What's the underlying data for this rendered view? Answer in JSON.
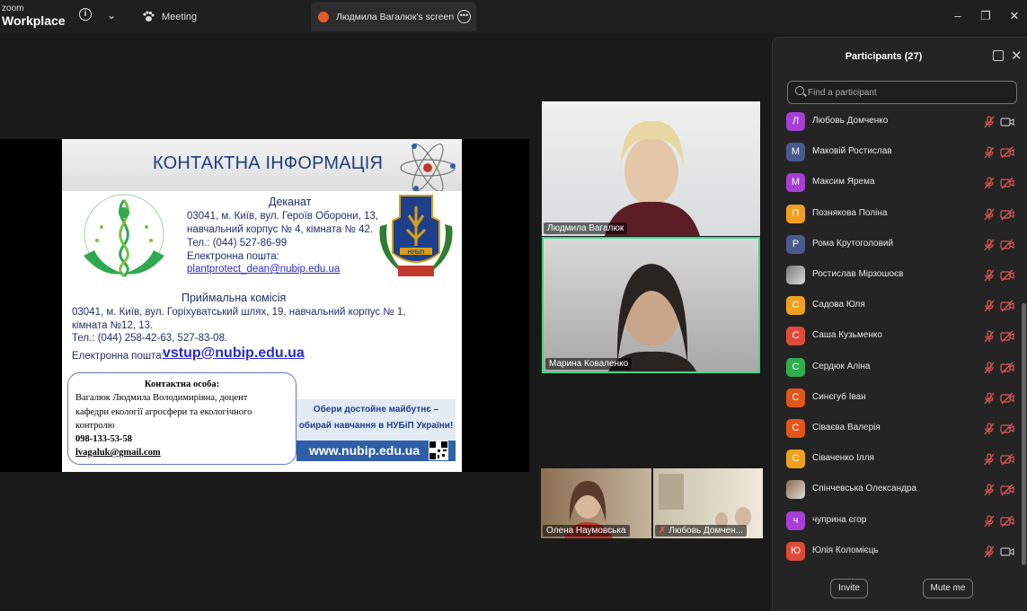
{
  "titlebar": {
    "brand_top": "zoom",
    "brand_bottom": "Workplace",
    "meeting_tab": "Meeting",
    "share_tab": "Людмила Вагалюк's screen"
  },
  "slide": {
    "title": "КОНТАКТНА ІНФОРМАЦІЯ",
    "dean_title": "Деканат",
    "dean_line1": "03041, м. Київ, вул. Героїв Оборони, 13,",
    "dean_line2": "навчальний корпус № 4, кімната № 42.",
    "dean_phone": "Тел.: (044) 527-86-99",
    "dean_email_label": "Електронна пошта:",
    "dean_email": "plantprotect_dean@nubip.edu.ua",
    "adm_title": "Приймальна комісія",
    "adm_line1": "03041, м. Київ, вул. Горіхуватський шлях, 19, навчальний корпус № 1,",
    "adm_line2": "кімната №12, 13.",
    "adm_phone": "Тел.: (044) 258-42-63, 527-83-08.",
    "adm_email_label": "Електронна пошта:",
    "adm_email": "vstup@nubip.edu.ua",
    "contact_title": "Контактна особа:",
    "contact_line1": "Вагалюк Людмила Володимирівна,  доцент",
    "contact_line2": "кафедри екології агросфери та екологічного",
    "contact_line3": "контролю",
    "contact_phone": "098-133-53-58",
    "contact_email": "lvagaluk@gmail.com",
    "promo_line1": "Обери достойне майбутнє –",
    "promo_line2": "обирай навчання в НУБіП України!",
    "url": "www.nubip.edu.ua",
    "logo_right_text": "НУБіП"
  },
  "videos": [
    {
      "name": "Людмила Вагалюк"
    },
    {
      "name": "Марина Коваленко"
    },
    {
      "name": "Олена Наумовська"
    },
    {
      "name": "Любовь Домчен..."
    }
  ],
  "participants_panel": {
    "title": "Participants (27)",
    "search_placeholder": "Find a participant",
    "invite_label": "Invite",
    "mute_me_label": "Mute me",
    "items": [
      {
        "initial": "Л",
        "name": "Любовь Домченко",
        "color": "#a63fd6",
        "cam": "on"
      },
      {
        "initial": "М",
        "name": "Маковій Ростислав",
        "color": "#4a5a8c",
        "cam": "off"
      },
      {
        "initial": "М",
        "name": "Максим Ярема",
        "color": "#a63fd6",
        "cam": "off"
      },
      {
        "initial": "П",
        "name": "Познякова Поліна",
        "color": "#f0a020",
        "cam": "off"
      },
      {
        "initial": "Р",
        "name": "Рома Крутоголовий",
        "color": "#4a5a8c",
        "cam": "off"
      },
      {
        "initial": "",
        "name": "Ростислав Мірзошоєв",
        "color": "#777777",
        "cam": "off"
      },
      {
        "initial": "С",
        "name": "Садова Юля",
        "color": "#f0a020",
        "cam": "off"
      },
      {
        "initial": "С",
        "name": "Саша Кузьменко",
        "color": "#e04a3a",
        "cam": "off"
      },
      {
        "initial": "С",
        "name": "Сердюк Аліна",
        "color": "#2fae4e",
        "cam": "off"
      },
      {
        "initial": "С",
        "name": "Синєгуб Іван",
        "color": "#e2561a",
        "cam": "off"
      },
      {
        "initial": "С",
        "name": "Сівaєва Валерія",
        "color": "#e2561a",
        "cam": "off"
      },
      {
        "initial": "С",
        "name": "Сіваченко Ілля",
        "color": "#f0a020",
        "cam": "off"
      },
      {
        "initial": "",
        "name": "Спінчевська Олександра",
        "color": "#8a6a4a",
        "cam": "off"
      },
      {
        "initial": "ч",
        "name": "чуприна єгор",
        "color": "#a63fd6",
        "cam": "off"
      },
      {
        "initial": "Ю",
        "name": "Юлія Коломієць",
        "color": "#e04a3a",
        "cam": "on"
      }
    ]
  }
}
